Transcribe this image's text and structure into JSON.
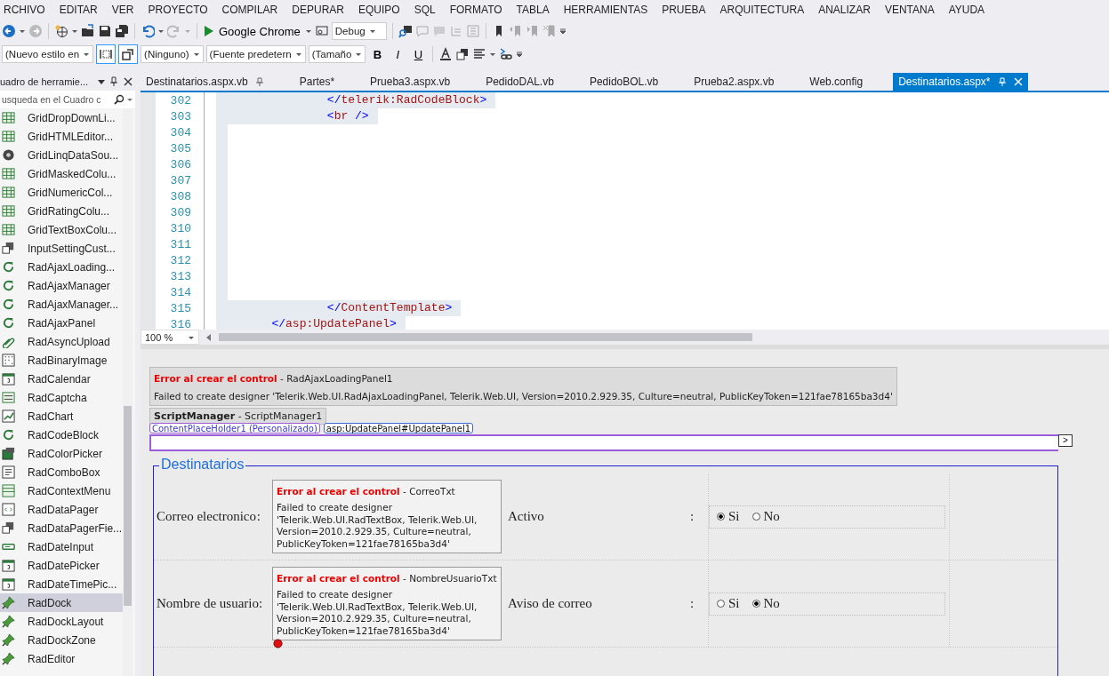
{
  "menu": [
    "RCHIVO",
    "EDITAR",
    "VER",
    "PROYECTO",
    "COMPILAR",
    "DEPURAR",
    "EQUIPO",
    "SQL",
    "FORMATO",
    "TABLA",
    "HERRAMIENTAS",
    "PRUEBA",
    "ARQUITECTURA",
    "ANALIZAR",
    "VENTANA",
    "AYUDA"
  ],
  "toolbar1": {
    "run_target": "Google Chrome",
    "configuration": "Debug"
  },
  "toolbar2": {
    "style": "(Nuevo estilo en",
    "block_format": "(Ninguno)",
    "font": "(Fuente predetern",
    "size": "(Tamaño",
    "bold": "B",
    "italic": "I",
    "underline": "U"
  },
  "toolbox": {
    "title": "uadro de herramie...",
    "search": {
      "placeholder": "usqueda en el Cuadro c"
    },
    "items": [
      {
        "label": "GridDropDownLi...",
        "kind": "grid",
        "selected": false
      },
      {
        "label": "GridHTMLEditor...",
        "kind": "grid",
        "selected": false
      },
      {
        "label": "GridLinqDataSou...",
        "kind": "datasource",
        "selected": false
      },
      {
        "label": "GridMaskedColu...",
        "kind": "grid",
        "selected": false
      },
      {
        "label": "GridNumericCol...",
        "kind": "grid",
        "selected": false
      },
      {
        "label": "GridRatingColu...",
        "kind": "grid",
        "selected": false
      },
      {
        "label": "GridTextBoxColu...",
        "kind": "grid",
        "selected": false
      },
      {
        "label": "InputSettingCust...",
        "kind": "generic",
        "selected": false
      },
      {
        "label": "RadAjaxLoading...",
        "kind": "ajax",
        "selected": false
      },
      {
        "label": "RadAjaxManager",
        "kind": "ajax",
        "selected": false
      },
      {
        "label": "RadAjaxManager...",
        "kind": "ajax",
        "selected": false
      },
      {
        "label": "RadAjaxPanel",
        "kind": "ajax",
        "selected": false
      },
      {
        "label": "RadAsyncUpload",
        "kind": "clip",
        "selected": false
      },
      {
        "label": "RadBinaryImage",
        "kind": "image",
        "selected": false
      },
      {
        "label": "RadCalendar",
        "kind": "calendar",
        "selected": false
      },
      {
        "label": "RadCaptcha",
        "kind": "captcha",
        "selected": false
      },
      {
        "label": "RadChart",
        "kind": "chart",
        "selected": false
      },
      {
        "label": "RadCodeBlock",
        "kind": "ajax",
        "selected": false
      },
      {
        "label": "RadColorPicker",
        "kind": "color",
        "selected": false
      },
      {
        "label": "RadComboBox",
        "kind": "list",
        "selected": false
      },
      {
        "label": "RadContextMenu",
        "kind": "menu",
        "selected": false
      },
      {
        "label": "RadDataPager",
        "kind": "pager",
        "selected": false
      },
      {
        "label": "RadDataPagerFie...",
        "kind": "generic",
        "selected": false
      },
      {
        "label": "RadDateInput",
        "kind": "input",
        "selected": false
      },
      {
        "label": "RadDatePicker",
        "kind": "calendar",
        "selected": false
      },
      {
        "label": "RadDateTimePic...",
        "kind": "calendar",
        "selected": false
      },
      {
        "label": "RadDock",
        "kind": "dock",
        "selected": true
      },
      {
        "label": "RadDockLayout",
        "kind": "dock",
        "selected": false
      },
      {
        "label": "RadDockZone",
        "kind": "dock",
        "selected": false
      },
      {
        "label": "RadEditor",
        "kind": "dock",
        "selected": false
      }
    ]
  },
  "tabs": [
    {
      "label": "Destinatarios.aspx.vb",
      "selected": false,
      "pinned": true
    },
    {
      "label": "Partes*",
      "selected": false,
      "pinned": false
    },
    {
      "label": "Prueba3.aspx.vb",
      "selected": false,
      "pinned": false
    },
    {
      "label": "PedidoDAL.vb",
      "selected": false,
      "pinned": false
    },
    {
      "label": "PedidoBOL.vb",
      "selected": false,
      "pinned": false
    },
    {
      "label": "Prueba2.aspx.vb",
      "selected": false,
      "pinned": false
    },
    {
      "label": "Web.config",
      "selected": false,
      "pinned": false
    },
    {
      "label": "Destinatarios.aspx*",
      "selected": true,
      "pinned": true
    }
  ],
  "editor": {
    "lines": [
      {
        "number": "302",
        "code": "                </telerik:RadCodeBlock>",
        "selected": true
      },
      {
        "number": "303",
        "code": "                <br />",
        "selected": true
      },
      {
        "number": "304",
        "selected": true
      },
      {
        "number": "305",
        "selected": true
      },
      {
        "number": "306",
        "selected": true
      },
      {
        "number": "307",
        "selected": true
      },
      {
        "number": "308",
        "selected": true
      },
      {
        "number": "309",
        "selected": true
      },
      {
        "number": "310",
        "selected": true
      },
      {
        "number": "311",
        "selected": true
      },
      {
        "number": "312",
        "selected": true
      },
      {
        "number": "313",
        "selected": true
      },
      {
        "number": "314",
        "selected": true
      },
      {
        "number": "315",
        "code": "                </ContentTemplate>",
        "selected": true
      },
      {
        "number": "316",
        "code": "        </asp:UpdatePanel>",
        "selected": true
      }
    ],
    "zoom": "100 %"
  },
  "designer": {
    "error": {
      "title": "Error al crear el control",
      "separator": "-",
      "control": "RadAjaxLoadingPanel1",
      "message": "Failed to create designer 'Telerik.Web.UI.RadAjaxLoadingPanel, Telerik.Web.UI, Version=2010.2.929.35, Culture=neutral, PublicKeyToken=121fae78165ba3d4'"
    },
    "script_manager": {
      "type": "ScriptManager",
      "separator": "-",
      "name": "ScriptManager1"
    },
    "content_tag": "ContentPlaceHolder1 (Personalizado)",
    "panel_tag": "asp:UpdatePanel#UpdatePanel1",
    "expand_button": ">",
    "fieldset": {
      "legend": "Destinatarios",
      "rows": [
        {
          "label": "Correo electronico",
          "colon": ":",
          "error": {
            "title": "Error al crear el control",
            "separator": "-",
            "control": "CorreoTxt",
            "message": "Failed to create designer 'Telerik.Web.UI.RadTextBox, Telerik.Web.UI, Version=2010.2.929.35, Culture=neutral, PublicKeyToken=121fae78165ba3d4'"
          },
          "label2": "Activo",
          "colon2": ":",
          "radios": [
            {
              "label": "Si",
              "selected": true
            },
            {
              "label": "No",
              "selected": false
            }
          ],
          "error_marker": false
        },
        {
          "label": "Nombre de usuario",
          "colon": ":",
          "error": {
            "title": "Error al crear el control",
            "separator": "-",
            "control": "NombreUsuarioTxt",
            "message": "Failed to create designer 'Telerik.Web.UI.RadTextBox, Telerik.Web.UI, Version=2010.2.929.35, Culture=neutral, PublicKeyToken=121fae78165ba3d4'"
          },
          "label2": "Aviso de correo",
          "colon2": ":",
          "radios": [
            {
              "label": "Si",
              "selected": false
            },
            {
              "label": "No",
              "selected": true
            }
          ],
          "error_marker": true
        }
      ]
    }
  }
}
